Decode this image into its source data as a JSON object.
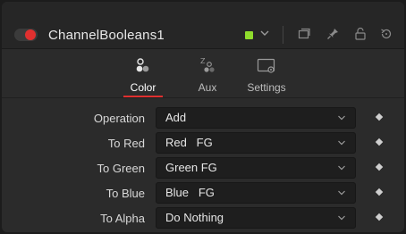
{
  "header": {
    "title": "ChannelBooleans1",
    "color_swatch": "#8fdc2c",
    "toggle_color": "#e0302f",
    "icons": [
      "toggle-icon",
      "chevron-down-icon",
      "window-icon",
      "pin-icon",
      "lock-icon",
      "reset-icon"
    ]
  },
  "tabs": [
    {
      "label": "Color",
      "icon": "color-circles-icon",
      "active": true
    },
    {
      "label": "Aux",
      "icon": "aux-z-icon",
      "active": false
    },
    {
      "label": "Settings",
      "icon": "settings-icon",
      "active": false
    }
  ],
  "rows": [
    {
      "label": "Operation",
      "value": "Add"
    },
    {
      "label": "To Red",
      "value": "Red   FG"
    },
    {
      "label": "To Green",
      "value": "Green FG"
    },
    {
      "label": "To Blue",
      "value": "Blue   FG"
    },
    {
      "label": "To Alpha",
      "value": "Do Nothing"
    }
  ],
  "colors": {
    "accent": "#e0302f",
    "panel": "#2b2b2b"
  }
}
